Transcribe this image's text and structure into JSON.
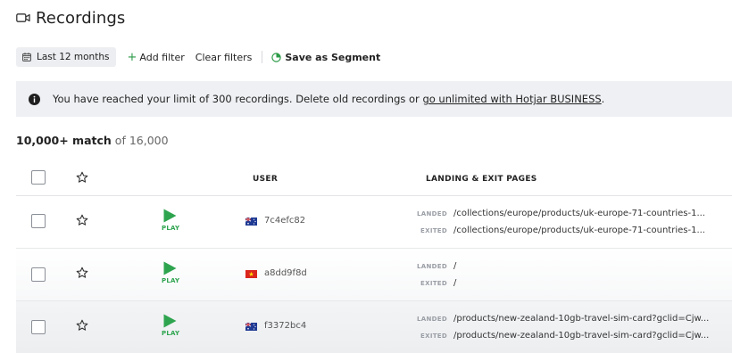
{
  "header": {
    "title": "Recordings",
    "icon": "video-camera-icon"
  },
  "filters": {
    "date_range": "Last 12 months",
    "add_filter": "Add filter",
    "add_prefix": "+",
    "clear_filters": "Clear filters",
    "save_segment": "Save as Segment"
  },
  "banner": {
    "message": "You have reached your limit of 300 recordings. Delete old recordings or ",
    "link": "go unlimited with Hotjar BUSINESS",
    "suffix": "."
  },
  "summary": {
    "count": "10,000+ match",
    "of_total": "of 16,000"
  },
  "table": {
    "columns": {
      "user": "USER",
      "pages": "LANDING & EXIT PAGES"
    },
    "play_label": "PLAY",
    "landed_label": "LANDED",
    "exited_label": "EXITED",
    "rows": [
      {
        "user_id": "7c4efc82",
        "flag": "australia",
        "landed": "/collections/europe/products/uk-europe-71-countries-1...",
        "exited": "/collections/europe/products/uk-europe-71-countries-1..."
      },
      {
        "user_id": "a8dd9f8d",
        "flag": "vietnam",
        "landed": "/",
        "exited": "/"
      },
      {
        "user_id": "f3372bc4",
        "flag": "australia",
        "landed": "/products/new-zealand-10gb-travel-sim-card?gclid=Cjw...",
        "exited": "/products/new-zealand-10gb-travel-sim-card?gclid=Cjw..."
      }
    ]
  },
  "colors": {
    "play_green": "#2ea44f",
    "banner_bg": "#eef0f3",
    "add_green": "#2a9a46"
  }
}
